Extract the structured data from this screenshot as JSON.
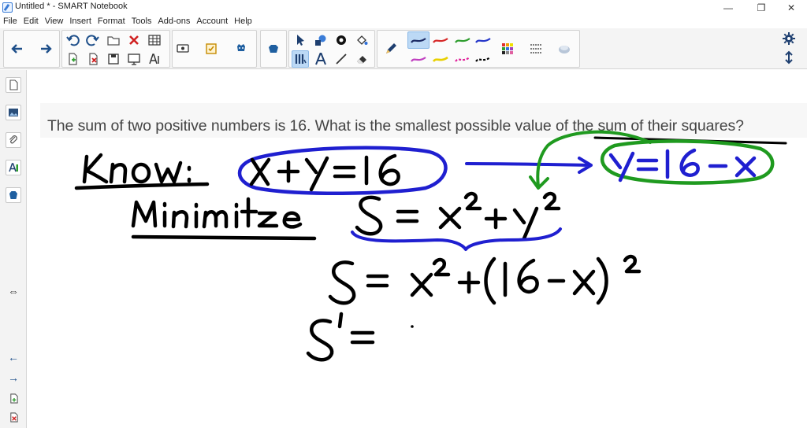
{
  "window": {
    "title": "Untitled * - SMART Notebook",
    "controls": {
      "minimize": "—",
      "maximize": "❐",
      "close": "✕"
    }
  },
  "menu": [
    "File",
    "Edit",
    "View",
    "Insert",
    "Format",
    "Tools",
    "Add-ons",
    "Account",
    "Help"
  ],
  "toolbar": {
    "icons": [
      "back-arrow-icon",
      "forward-arrow-icon",
      "undo-icon",
      "redo-icon",
      "add-page-icon",
      "delete-icon",
      "table-icon",
      "screen-shade-icon",
      "document-camera-icon",
      "response-icon",
      "add-ons-icon",
      "select-icon",
      "shapes-icon",
      "fill-icon",
      "eraser-icon",
      "pen-icon",
      "line-icon",
      "text-icon",
      "settings-icon"
    ],
    "pen_colors": [
      "#1b2a63",
      "#d62828",
      "#2e9d2e",
      "#2536c9",
      "#c040c0",
      "#e8d000",
      "#e0209a",
      "#000000"
    ]
  },
  "content": {
    "question": "The sum of two positive numbers is 16. What is the smallest possible value of the sum of their squares?"
  },
  "colors": {
    "ink_black": "#000000",
    "ink_blue": "#1f1fd0",
    "ink_green": "#1f9a1f",
    "selected": "#bcd9f5"
  }
}
